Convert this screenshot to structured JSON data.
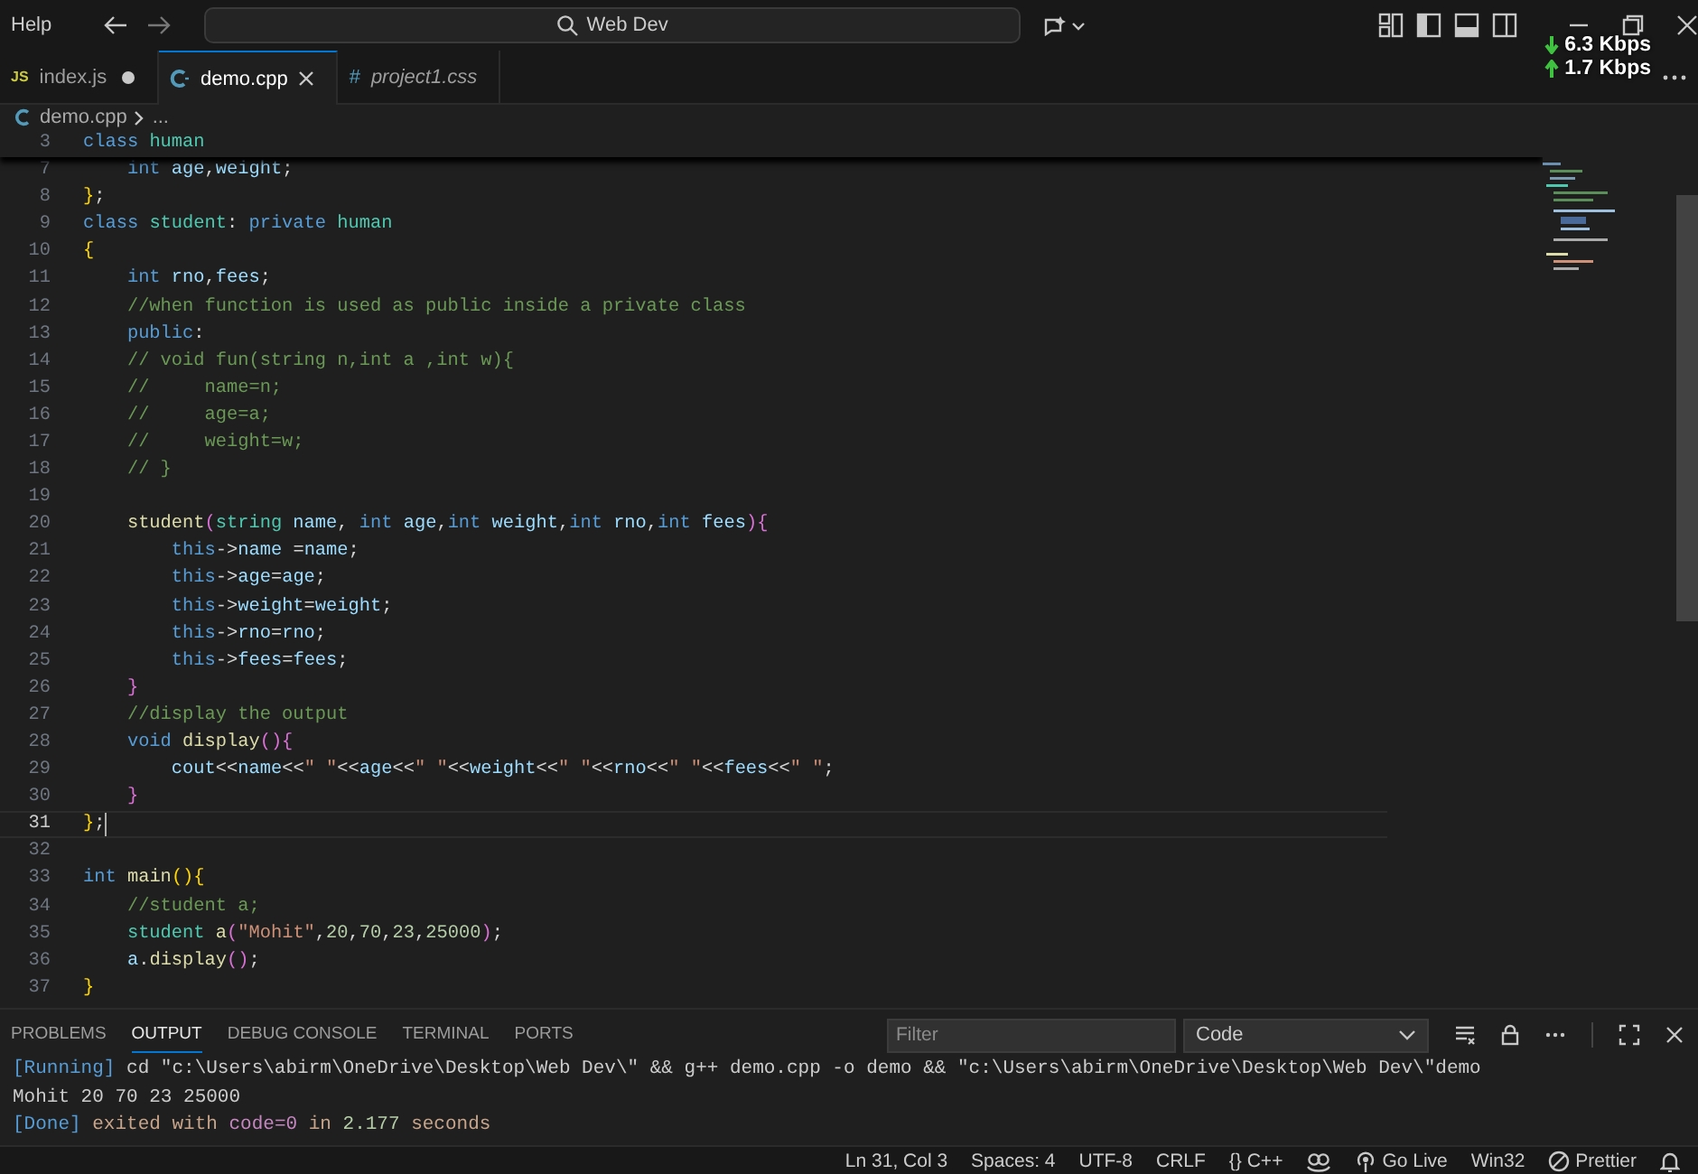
{
  "title_bar": {
    "menu": "Help",
    "search": "Web Dev"
  },
  "network_overlay": [
    {
      "kind": "down",
      "reading": "6.3 Kbps"
    },
    {
      "kind": "up",
      "reading": "1.7 Kbps"
    }
  ],
  "tabs": [
    {
      "kind": "js",
      "badge": "JS",
      "label": "index.js",
      "selected": false,
      "modified": true,
      "preview": false
    },
    {
      "kind": "cpp",
      "label": "demo.cpp",
      "selected": true,
      "modified": false,
      "preview": false
    },
    {
      "kind": "css",
      "badge": "#",
      "label": "project1.css",
      "selected": false,
      "modified": false,
      "preview": true
    }
  ],
  "breadcrumb": {
    "file": "demo.cpp",
    "rest": "..."
  },
  "editor": {
    "sticky_line": {
      "number": "3",
      "tokens": [
        {
          "text": "class ",
          "kind": "kw"
        },
        {
          "text": "human",
          "kind": "type"
        }
      ]
    },
    "lines": [
      {
        "number": "7",
        "current": false,
        "tokens": [
          {
            "text": "    int ",
            "kind": "kw"
          },
          {
            "text": "age",
            "kind": "var"
          },
          {
            "text": ",",
            "kind": "punc"
          },
          {
            "text": "weight",
            "kind": "var"
          },
          {
            "text": ";",
            "kind": "punc"
          }
        ]
      },
      {
        "number": "8",
        "current": false,
        "tokens": [
          {
            "text": "}",
            "kind": "brace1"
          },
          {
            "text": ";",
            "kind": "punc"
          }
        ]
      },
      {
        "number": "9",
        "current": false,
        "tokens": [
          {
            "text": "class ",
            "kind": "kw"
          },
          {
            "text": "student",
            "kind": "type"
          },
          {
            "text": ": ",
            "kind": "punc"
          },
          {
            "text": "private ",
            "kind": "kw"
          },
          {
            "text": "human",
            "kind": "type"
          }
        ]
      },
      {
        "number": "10",
        "current": false,
        "tokens": [
          {
            "text": "{",
            "kind": "brace1"
          }
        ]
      },
      {
        "number": "11",
        "current": false,
        "tokens": [
          {
            "text": "    int ",
            "kind": "kw"
          },
          {
            "text": "rno",
            "kind": "var"
          },
          {
            "text": ",",
            "kind": "punc"
          },
          {
            "text": "fees",
            "kind": "var"
          },
          {
            "text": ";",
            "kind": "punc"
          }
        ]
      },
      {
        "number": "12",
        "current": false,
        "tokens": [
          {
            "text": "    //when function is used as public inside a private class",
            "kind": "com"
          }
        ]
      },
      {
        "number": "13",
        "current": false,
        "tokens": [
          {
            "text": "    public",
            "kind": "kw"
          },
          {
            "text": ":",
            "kind": "punc"
          }
        ]
      },
      {
        "number": "14",
        "current": false,
        "tokens": [
          {
            "text": "    // void fun(string n,int a ,int w){",
            "kind": "com"
          }
        ]
      },
      {
        "number": "15",
        "current": false,
        "tokens": [
          {
            "text": "    //     name=n;",
            "kind": "com"
          }
        ]
      },
      {
        "number": "16",
        "current": false,
        "tokens": [
          {
            "text": "    //     age=a;",
            "kind": "com"
          }
        ]
      },
      {
        "number": "17",
        "current": false,
        "tokens": [
          {
            "text": "    //     weight=w;",
            "kind": "com"
          }
        ]
      },
      {
        "number": "18",
        "current": false,
        "tokens": [
          {
            "text": "    // }",
            "kind": "com"
          }
        ]
      },
      {
        "number": "19",
        "current": false
      },
      {
        "number": "20",
        "current": false,
        "tokens": [
          {
            "text": "    student",
            "kind": "fn"
          },
          {
            "text": "(",
            "kind": "brace2"
          },
          {
            "text": "string ",
            "kind": "type"
          },
          {
            "text": "name",
            "kind": "var"
          },
          {
            "text": ", ",
            "kind": "punc"
          },
          {
            "text": "int ",
            "kind": "kw"
          },
          {
            "text": "age",
            "kind": "var"
          },
          {
            "text": ",",
            "kind": "punc"
          },
          {
            "text": "int ",
            "kind": "kw"
          },
          {
            "text": "weight",
            "kind": "var"
          },
          {
            "text": ",",
            "kind": "punc"
          },
          {
            "text": "int ",
            "kind": "kw"
          },
          {
            "text": "rno",
            "kind": "var"
          },
          {
            "text": ",",
            "kind": "punc"
          },
          {
            "text": "int ",
            "kind": "kw"
          },
          {
            "text": "fees",
            "kind": "var"
          },
          {
            "text": "){",
            "kind": "brace2"
          }
        ]
      },
      {
        "number": "21",
        "current": false,
        "tokens": [
          {
            "text": "        this",
            "kind": "kw"
          },
          {
            "text": "->",
            "kind": "punc"
          },
          {
            "text": "name ",
            "kind": "var"
          },
          {
            "text": "=",
            "kind": "punc"
          },
          {
            "text": "name",
            "kind": "var"
          },
          {
            "text": ";",
            "kind": "punc"
          }
        ]
      },
      {
        "number": "22",
        "current": false,
        "tokens": [
          {
            "text": "        this",
            "kind": "kw"
          },
          {
            "text": "->",
            "kind": "punc"
          },
          {
            "text": "age",
            "kind": "var"
          },
          {
            "text": "=",
            "kind": "punc"
          },
          {
            "text": "age",
            "kind": "var"
          },
          {
            "text": ";",
            "kind": "punc"
          }
        ]
      },
      {
        "number": "23",
        "current": false,
        "tokens": [
          {
            "text": "        this",
            "kind": "kw"
          },
          {
            "text": "->",
            "kind": "punc"
          },
          {
            "text": "weight",
            "kind": "var"
          },
          {
            "text": "=",
            "kind": "punc"
          },
          {
            "text": "weight",
            "kind": "var"
          },
          {
            "text": ";",
            "kind": "punc"
          }
        ]
      },
      {
        "number": "24",
        "current": false,
        "tokens": [
          {
            "text": "        this",
            "kind": "kw"
          },
          {
            "text": "->",
            "kind": "punc"
          },
          {
            "text": "rno",
            "kind": "var"
          },
          {
            "text": "=",
            "kind": "punc"
          },
          {
            "text": "rno",
            "kind": "var"
          },
          {
            "text": ";",
            "kind": "punc"
          }
        ]
      },
      {
        "number": "25",
        "current": false,
        "tokens": [
          {
            "text": "        this",
            "kind": "kw"
          },
          {
            "text": "->",
            "kind": "punc"
          },
          {
            "text": "fees",
            "kind": "var"
          },
          {
            "text": "=",
            "kind": "punc"
          },
          {
            "text": "fees",
            "kind": "var"
          },
          {
            "text": ";",
            "kind": "punc"
          }
        ]
      },
      {
        "number": "26",
        "current": false,
        "tokens": [
          {
            "text": "    }",
            "kind": "brace2"
          }
        ]
      },
      {
        "number": "27",
        "current": false,
        "tokens": [
          {
            "text": "    //display the output",
            "kind": "com"
          }
        ]
      },
      {
        "number": "28",
        "current": false,
        "tokens": [
          {
            "text": "    void ",
            "kind": "kw"
          },
          {
            "text": "display",
            "kind": "fn"
          },
          {
            "text": "(){",
            "kind": "brace2"
          }
        ]
      },
      {
        "number": "29",
        "current": false,
        "tokens": [
          {
            "text": "        cout",
            "kind": "var"
          },
          {
            "text": "<<",
            "kind": "punc"
          },
          {
            "text": "name",
            "kind": "var"
          },
          {
            "text": "<<",
            "kind": "punc"
          },
          {
            "text": "\" \"",
            "kind": "str"
          },
          {
            "text": "<<",
            "kind": "punc"
          },
          {
            "text": "age",
            "kind": "var"
          },
          {
            "text": "<<",
            "kind": "punc"
          },
          {
            "text": "\" \"",
            "kind": "str"
          },
          {
            "text": "<<",
            "kind": "punc"
          },
          {
            "text": "weight",
            "kind": "var"
          },
          {
            "text": "<<",
            "kind": "punc"
          },
          {
            "text": "\" \"",
            "kind": "str"
          },
          {
            "text": "<<",
            "kind": "punc"
          },
          {
            "text": "rno",
            "kind": "var"
          },
          {
            "text": "<<",
            "kind": "punc"
          },
          {
            "text": "\" \"",
            "kind": "str"
          },
          {
            "text": "<<",
            "kind": "punc"
          },
          {
            "text": "fees",
            "kind": "var"
          },
          {
            "text": "<<",
            "kind": "punc"
          },
          {
            "text": "\" \"",
            "kind": "str"
          },
          {
            "text": ";",
            "kind": "punc"
          }
        ]
      },
      {
        "number": "30",
        "current": false,
        "tokens": [
          {
            "text": "    }",
            "kind": "brace2"
          }
        ]
      },
      {
        "number": "31",
        "current": true,
        "tokens": [
          {
            "text": "}",
            "kind": "brace1"
          },
          {
            "text": ";",
            "kind": "punc"
          }
        ]
      },
      {
        "number": "32",
        "current": false
      },
      {
        "number": "33",
        "current": false,
        "tokens": [
          {
            "text": "int ",
            "kind": "kw"
          },
          {
            "text": "main",
            "kind": "fn"
          },
          {
            "text": "(){",
            "kind": "brace1"
          }
        ]
      },
      {
        "number": "34",
        "current": false,
        "tokens": [
          {
            "text": "    //student a;",
            "kind": "com"
          }
        ]
      },
      {
        "number": "35",
        "current": false,
        "tokens": [
          {
            "text": "    student ",
            "kind": "type"
          },
          {
            "text": "a",
            "kind": "fn"
          },
          {
            "text": "(",
            "kind": "brace2"
          },
          {
            "text": "\"Mohit\"",
            "kind": "str"
          },
          {
            "text": ",",
            "kind": "punc"
          },
          {
            "text": "20",
            "kind": "num"
          },
          {
            "text": ",",
            "kind": "punc"
          },
          {
            "text": "70",
            "kind": "num"
          },
          {
            "text": ",",
            "kind": "punc"
          },
          {
            "text": "23",
            "kind": "num"
          },
          {
            "text": ",",
            "kind": "punc"
          },
          {
            "text": "25000",
            "kind": "num"
          },
          {
            "text": ")",
            "kind": "brace2"
          },
          {
            "text": ";",
            "kind": "punc"
          }
        ]
      },
      {
        "number": "36",
        "current": false,
        "tokens": [
          {
            "text": "    a",
            "kind": "var"
          },
          {
            "text": ".",
            "kind": "punc"
          },
          {
            "text": "display",
            "kind": "fn"
          },
          {
            "text": "()",
            "kind": "brace2"
          },
          {
            "text": ";",
            "kind": "punc"
          }
        ]
      },
      {
        "number": "37",
        "current": false,
        "tokens": [
          {
            "text": "}",
            "kind": "brace1"
          }
        ]
      }
    ]
  },
  "panel": {
    "tabs": [
      {
        "label": "PROBLEMS",
        "selected": false
      },
      {
        "label": "OUTPUT",
        "selected": true
      },
      {
        "label": "DEBUG CONSOLE",
        "selected": false
      },
      {
        "label": "TERMINAL",
        "selected": false
      },
      {
        "label": "PORTS",
        "selected": false
      }
    ],
    "filter": {
      "placeholder": "Filter"
    },
    "channel": "Code",
    "output": [
      {
        "tokens": [
          {
            "text": "[Running]",
            "kind": "tag"
          },
          {
            "text": " cd \"c:\\Users\\abirm\\OneDrive\\Desktop\\Web Dev\\\" && g++ demo.cpp -o demo && \"c:\\Users\\abirm\\OneDrive\\Desktop\\Web Dev\\\"demo",
            "kind": "plain"
          }
        ]
      },
      {
        "tokens": [
          {
            "text": "Mohit 20 70 23 25000",
            "kind": "plain"
          }
        ]
      },
      {
        "tokens": [
          {
            "text": "[Done]",
            "kind": "tag"
          },
          {
            "text": " exited with ",
            "kind": "muted"
          },
          {
            "text": "code=0",
            "kind": "code"
          },
          {
            "text": " in ",
            "kind": "muted"
          },
          {
            "text": "2.177",
            "kind": "num"
          },
          {
            "text": " seconds",
            "kind": "muted"
          }
        ]
      }
    ]
  },
  "status_bar": [
    {
      "kind": "text",
      "label": "Ln 31, Col 3"
    },
    {
      "kind": "text",
      "label": "Spaces: 4"
    },
    {
      "kind": "text",
      "label": "UTF-8"
    },
    {
      "kind": "text",
      "label": "CRLF"
    },
    {
      "kind": "text",
      "label": "{} C++"
    },
    {
      "kind": "copilot"
    },
    {
      "kind": "golive",
      "label": "Go Live"
    },
    {
      "kind": "text",
      "label": "Win32"
    },
    {
      "kind": "prettier",
      "label": "Prettier"
    },
    {
      "kind": "bell"
    }
  ]
}
